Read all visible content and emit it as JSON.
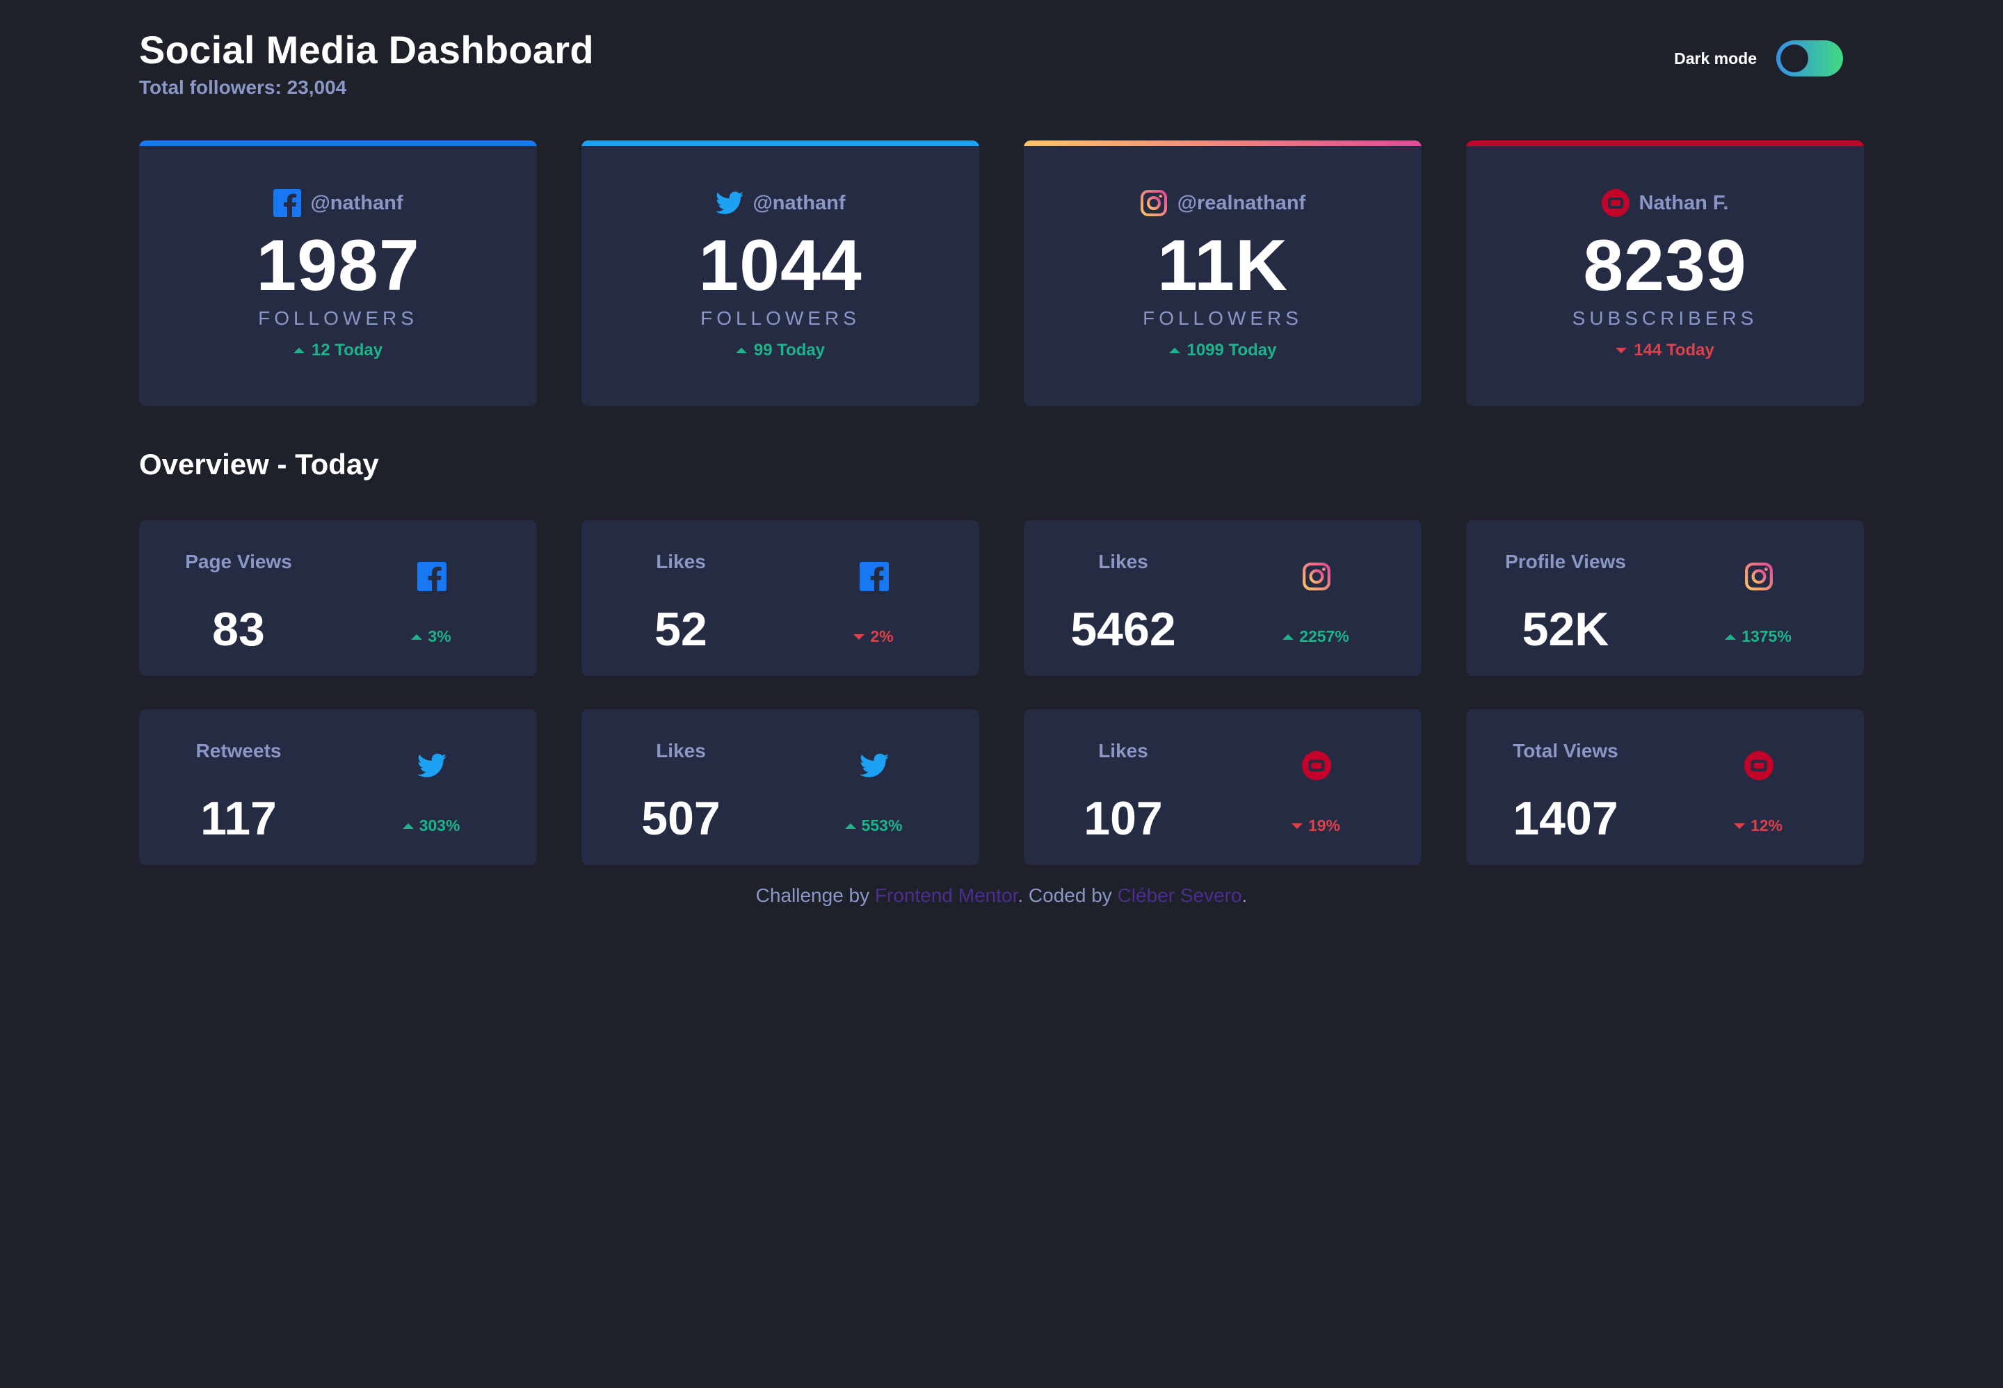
{
  "header": {
    "title": "Social Media Dashboard",
    "subtitle": "Total followers: 23,004",
    "toggle_label": "Dark mode"
  },
  "colors": {
    "facebook": "#1877f2",
    "twitter": "#1da1f2",
    "instagram_start": "#fdc468",
    "instagram_end": "#df4996",
    "youtube": "#c4032a",
    "up": "#1db489",
    "down": "#dc414c"
  },
  "followers": [
    {
      "platform": "facebook",
      "icon": "facebook-icon",
      "handle": "@nathanf",
      "count": "1987",
      "unit": "FOLLOWERS",
      "today": "12 Today",
      "trend": "up"
    },
    {
      "platform": "twitter",
      "icon": "twitter-icon",
      "handle": "@nathanf",
      "count": "1044",
      "unit": "FOLLOWERS",
      "today": "99 Today",
      "trend": "up"
    },
    {
      "platform": "instagram",
      "icon": "instagram-icon",
      "handle": "@realnathanf",
      "count": "11K",
      "unit": "FOLLOWERS",
      "today": "1099 Today",
      "trend": "up"
    },
    {
      "platform": "youtube",
      "icon": "youtube-icon",
      "handle": "Nathan F.",
      "count": "8239",
      "unit": "SUBSCRIBERS",
      "today": "144 Today",
      "trend": "down"
    }
  ],
  "overview": {
    "title": "Overview - Today",
    "items": [
      {
        "label": "Page Views",
        "icon": "facebook-icon",
        "value": "83",
        "change": "3%",
        "trend": "up"
      },
      {
        "label": "Likes",
        "icon": "facebook-icon",
        "value": "52",
        "change": "2%",
        "trend": "down"
      },
      {
        "label": "Likes",
        "icon": "instagram-icon",
        "value": "5462",
        "change": "2257%",
        "trend": "up"
      },
      {
        "label": "Profile Views",
        "icon": "instagram-icon",
        "value": "52K",
        "change": "1375%",
        "trend": "up"
      },
      {
        "label": "Retweets",
        "icon": "twitter-icon",
        "value": "117",
        "change": "303%",
        "trend": "up"
      },
      {
        "label": "Likes",
        "icon": "twitter-icon",
        "value": "507",
        "change": "553%",
        "trend": "up"
      },
      {
        "label": "Likes",
        "icon": "youtube-icon",
        "value": "107",
        "change": "19%",
        "trend": "down"
      },
      {
        "label": "Total Views",
        "icon": "youtube-icon",
        "value": "1407",
        "change": "12%",
        "trend": "down"
      }
    ]
  },
  "footer": {
    "prefix": "Challenge by ",
    "link1": "Frontend Mentor",
    "middle": ". Coded by ",
    "link2": "Cléber Severo",
    "suffix": "."
  }
}
